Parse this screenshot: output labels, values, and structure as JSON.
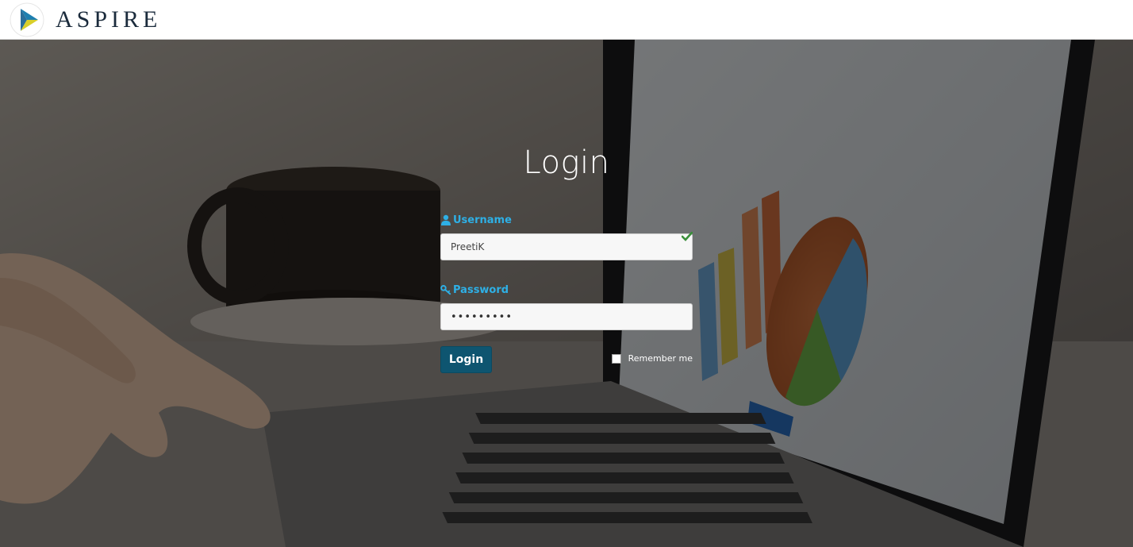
{
  "header": {
    "brand": "ASPIRE"
  },
  "login": {
    "title": "Login",
    "username_label": "Username",
    "username_value": "PreetiK",
    "password_label": "Password",
    "password_value": "•••••••••",
    "login_button": "Login",
    "remember_label": "Remember me"
  },
  "icons": {
    "logo": "aspire-logo-icon",
    "username": "user-icon",
    "password": "key-icon",
    "valid": "checkmark-icon"
  },
  "colors": {
    "accent": "#2eb0e6",
    "button": "#0e5570",
    "brand_text": "#1b2b3c",
    "valid": "#3a8f3a"
  }
}
